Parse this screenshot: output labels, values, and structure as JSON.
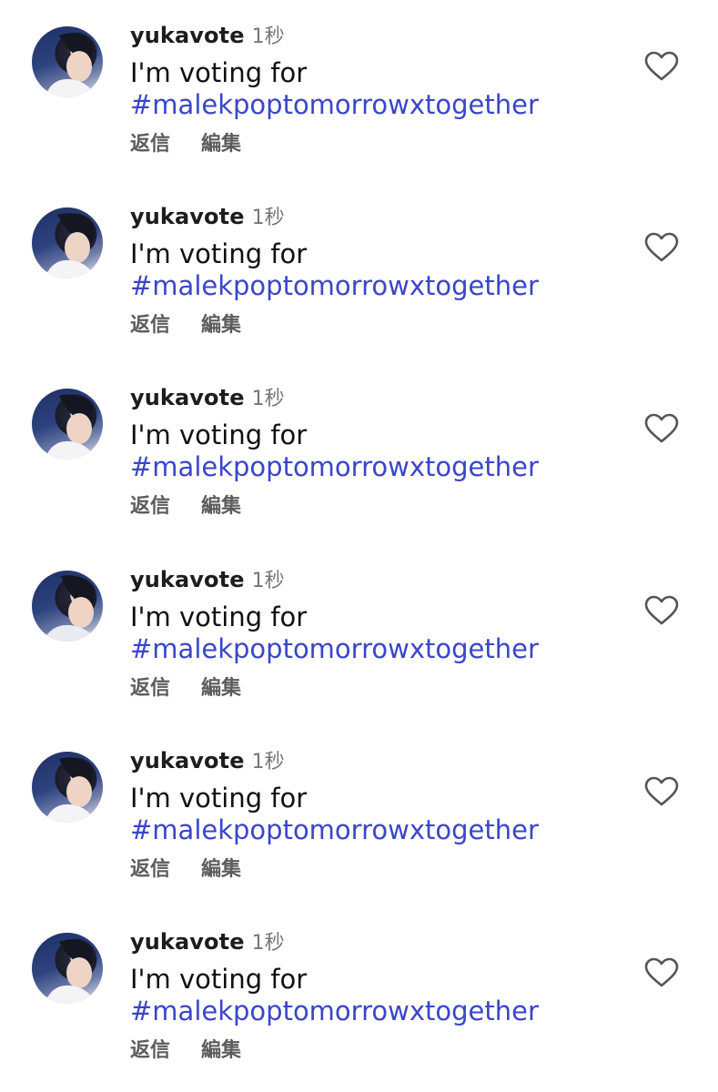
{
  "comments": [
    {
      "username": "yukavote",
      "time": "1秒",
      "text": "I'm voting for",
      "hashtag": "#malekpoptomorrowxtogether",
      "reply_label": "返信",
      "edit_label": "編集"
    },
    {
      "username": "yukavote",
      "time": "1秒",
      "text": "I'm voting for",
      "hashtag": "#malekpoptomorrowxtogether",
      "reply_label": "返信",
      "edit_label": "編集"
    },
    {
      "username": "yukavote",
      "time": "1秒",
      "text": "I'm voting for",
      "hashtag": "#malekpoptomorrowxtogether",
      "reply_label": "返信",
      "edit_label": "編集"
    },
    {
      "username": "yukavote",
      "time": "1秒",
      "text": "I'm voting for",
      "hashtag": "#malekpoptomorrowxtogether",
      "reply_label": "返信",
      "edit_label": "編集"
    },
    {
      "username": "yukavote",
      "time": "1秒",
      "text": "I'm voting for",
      "hashtag": "#malekpoptomorrowxtogether",
      "reply_label": "返信",
      "edit_label": "編集"
    },
    {
      "username": "yukavote",
      "time": "1秒",
      "text": "I'm voting for",
      "hashtag": "#malekpoptomorrowxtogether",
      "reply_label": "返信",
      "edit_label": "編集"
    }
  ],
  "icons": {
    "avatar": "profile-photo",
    "like": "heart-outline-icon"
  },
  "colors": {
    "hashtag": "#3a46c9",
    "username": "#1d1d1d",
    "timestamp": "#767676",
    "action": "#5c5c5c",
    "heart_stroke": "#555555"
  }
}
